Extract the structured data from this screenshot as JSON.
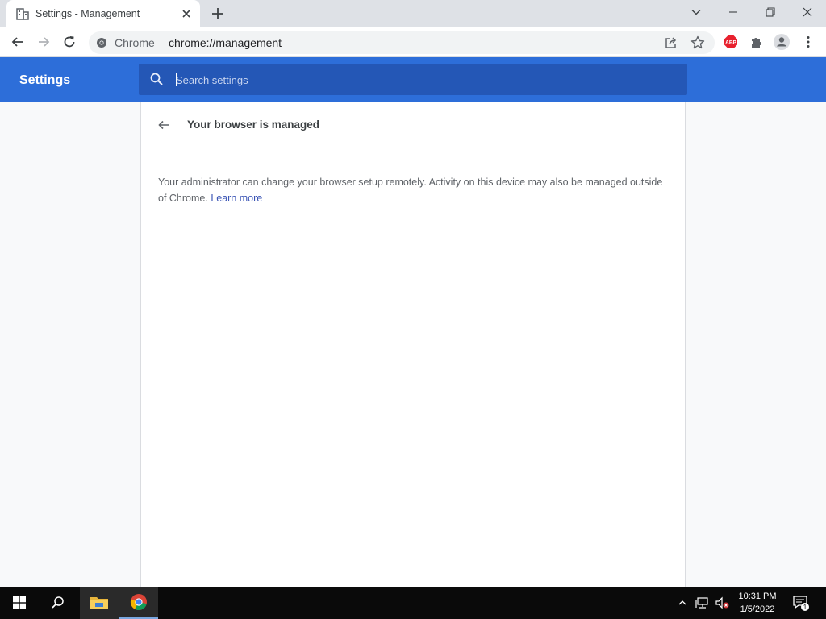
{
  "tab": {
    "title": "Settings - Management"
  },
  "omnibox": {
    "chip": "Chrome",
    "url": "chrome://management"
  },
  "extensions": {
    "abp_label": "ABP"
  },
  "settings": {
    "title": "Settings",
    "search_placeholder": "Search settings"
  },
  "page": {
    "title": "Your browser is managed",
    "description": "Your administrator can change your browser setup remotely. Activity on this device may also be managed outside of Chrome.",
    "learn_more": "Learn more"
  },
  "taskbar": {
    "time": "10:31 PM",
    "date": "1/5/2022",
    "notification_count": "1"
  },
  "colors": {
    "header_blue": "#2d6ed9",
    "search_blue": "#2457b6",
    "link": "#3b55b5",
    "tab_strip": "#dee1e6"
  }
}
